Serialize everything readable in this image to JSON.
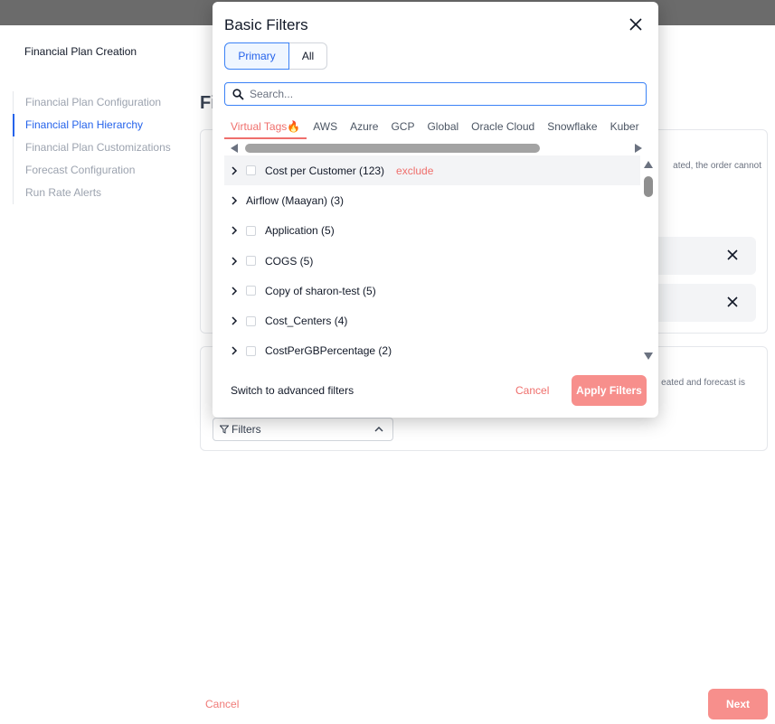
{
  "page": {
    "header_title": "Financial Plan Creation",
    "main_title_fragment": "Fi",
    "card1_text": "ated, the order cannot",
    "card2_text": "eated and forecast is",
    "filters_button_label": "Filters",
    "cancel_label": "Cancel",
    "next_label": "Next"
  },
  "side_nav": {
    "items": [
      {
        "label": "Financial Plan Configuration"
      },
      {
        "label": "Financial Plan Hierarchy"
      },
      {
        "label": "Financial Plan Customizations"
      },
      {
        "label": "Forecast Configuration"
      },
      {
        "label": "Run Rate Alerts"
      }
    ],
    "active_index": 1
  },
  "modal": {
    "title": "Basic Filters",
    "segments": {
      "primary": "Primary",
      "all": "All",
      "selected": "Primary"
    },
    "search": {
      "placeholder": "Search...",
      "value": ""
    },
    "tabs": [
      {
        "label": "Virtual Tags🔥"
      },
      {
        "label": "AWS"
      },
      {
        "label": "Azure"
      },
      {
        "label": "GCP"
      },
      {
        "label": "Global"
      },
      {
        "label": "Oracle Cloud"
      },
      {
        "label": "Snowflake"
      },
      {
        "label": "Kuber"
      }
    ],
    "active_tab": "Virtual Tags🔥",
    "list": [
      {
        "label": "Cost per Customer (123)",
        "checkbox": true,
        "exclude": "exclude"
      },
      {
        "label": "Airflow (Maayan) (3)",
        "checkbox": false
      },
      {
        "label": "Application (5)",
        "checkbox": true
      },
      {
        "label": "COGS (5)",
        "checkbox": true
      },
      {
        "label": "Copy of sharon-test (5)",
        "checkbox": true
      },
      {
        "label": "Cost_Centers (4)",
        "checkbox": true
      },
      {
        "label": "CostPerGBPercentage (2)",
        "checkbox": true
      }
    ],
    "switch_label": "Switch to advanced filters",
    "cancel_label": "Cancel",
    "apply_label": "Apply Filters"
  },
  "colors": {
    "accent_blue": "#2563eb",
    "accent_coral": "#ef6f6c",
    "button_coral": "#f78f8c"
  }
}
